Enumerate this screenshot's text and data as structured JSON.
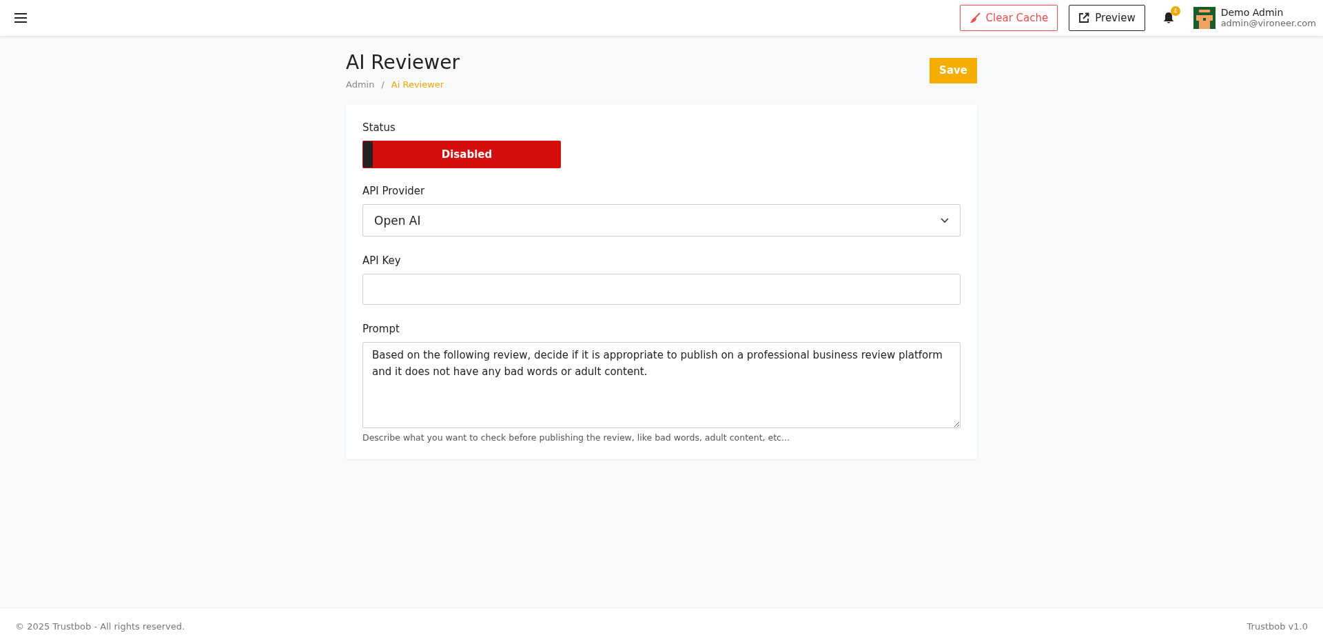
{
  "header": {
    "clear_cache": "Clear Cache",
    "preview": "Preview",
    "notifications": "4",
    "user": {
      "name": "Demo Admin",
      "email": "admin@vironeer.com"
    }
  },
  "page": {
    "title": "AI Reviewer",
    "breadcrumb_separator": "/",
    "breadcrumb": [
      {
        "label": "Admin",
        "selected": false
      },
      {
        "label": "Ai Reviewer",
        "selected": true
      }
    ],
    "save": "Save"
  },
  "form": {
    "status": {
      "label": "Status",
      "on": false,
      "text": "Disabled"
    },
    "provider": {
      "label": "API Provider",
      "value": "Open AI"
    },
    "api_key": {
      "label": "API Key"
    },
    "prompt": {
      "label": "Prompt",
      "value": "Based on the following review, decide if it is appropriate to publish on a professional business review platform and it does not have any bad words or adult content.",
      "help": "Describe what you want to check before publishing the review, like bad words, adult content, etc..."
    }
  },
  "footer": {
    "copyright": "© 2025 Trustbob - All rights reserved.",
    "version": "Trustbob v1.0"
  }
}
